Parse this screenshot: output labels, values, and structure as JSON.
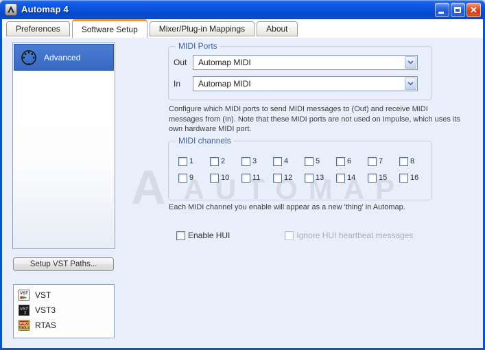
{
  "window": {
    "title": "Automap 4"
  },
  "window_controls": {
    "minimize": "minimize",
    "maximize": "maximize",
    "close": "✕"
  },
  "tabs": [
    {
      "label": "Preferences",
      "active": false
    },
    {
      "label": "Software Setup",
      "active": true
    },
    {
      "label": "Mixer/Plug-in Mappings",
      "active": false
    },
    {
      "label": "About",
      "active": false
    }
  ],
  "sidebar": {
    "advanced_label": "Advanced",
    "setup_vst_button": "Setup VST Paths...",
    "formats": [
      {
        "label": "VST",
        "icon": "vst-icon"
      },
      {
        "label": "VST3",
        "icon": "vst3-icon"
      },
      {
        "label": "RTAS",
        "icon": "protools-icon"
      }
    ]
  },
  "midi_ports": {
    "group_label": "MIDI Ports",
    "out_label": "Out",
    "out_value": "Automap MIDI",
    "in_label": "In",
    "in_value": "Automap MIDI",
    "description": "Configure which MIDI ports to send MIDI messages to (Out) and receive MIDI messages from (In). Note that these MIDI ports are not used on Impulse, which uses its own hardware MIDI port."
  },
  "midi_channels": {
    "group_label": "MIDI channels",
    "channels": [
      "1",
      "2",
      "3",
      "4",
      "5",
      "6",
      "7",
      "8",
      "9",
      "10",
      "11",
      "12",
      "13",
      "14",
      "15",
      "16"
    ],
    "all_unchecked": true,
    "note": "Each MIDI channel you enable will appear as a new 'thing' in Automap."
  },
  "hui": {
    "enable_label": "Enable HUI",
    "enable_checked": false,
    "ignore_label": "Ignore HUI heartbeat messages",
    "ignore_disabled": true
  },
  "watermark": {
    "letter": "A",
    "text": "AUTOMAP"
  },
  "colors": {
    "titlebar_blue": "#0C53DF",
    "selection_blue": "#3A6FC5",
    "tab_accent_orange": "#F0993C",
    "group_label_blue": "#3A5DA8",
    "pane_background": "#E9EFFA",
    "close_button_red": "#CC3E18"
  }
}
